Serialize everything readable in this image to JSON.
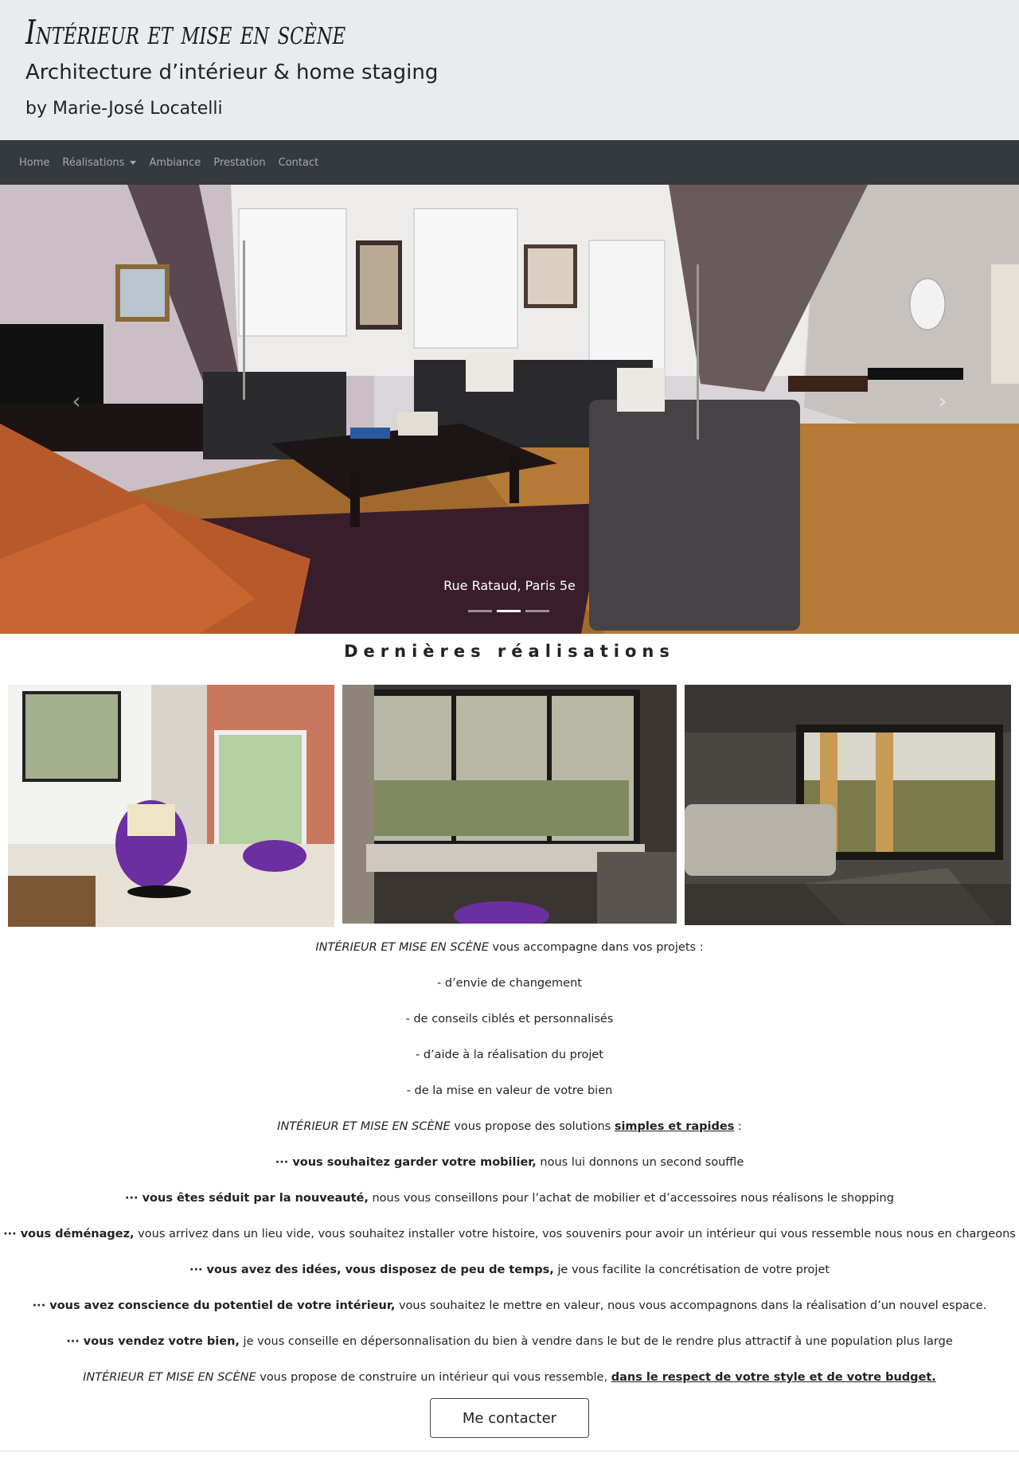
{
  "header": {
    "title": "Intérieur et mise en scène",
    "subtitle": "Architecture d’intérieur & home staging",
    "author": "by Marie-José Locatelli"
  },
  "nav": {
    "home": "Home",
    "realisations": "Réalisations",
    "ambiance": "Ambiance",
    "prestation": "Prestation",
    "contact": "Contact"
  },
  "carousel": {
    "caption": "Rue Rataud, Paris 5e",
    "prev_glyph": "‹",
    "next_glyph": "›",
    "active_index": 1,
    "slide_count": 3
  },
  "section": {
    "title": "Dernières réalisations"
  },
  "intro": {
    "brand": "INTÉRIEUR ET MISE EN SCÈNE",
    "accompagne": " vous accompagne dans vos projets :",
    "item1": "- d’envie de changement",
    "item2": "- de conseils ciblés et personnalisés",
    "item3": "- d’aide à la réalisation du projet",
    "item4": "- de la mise en valeur de votre bien",
    "propose": " vous propose des solutions ",
    "simples": "simples et rapides",
    "colon": " :"
  },
  "cases": [
    {
      "bold": "··· vous souhaitez garder votre mobilier,",
      "rest": " nous lui donnons un second souffle"
    },
    {
      "bold": "··· vous êtes séduit par la nouveauté,",
      "rest": " nous vous conseillons pour l’achat de mobilier et d’accessoires nous réalisons le shopping"
    },
    {
      "bold": "··· vous déménagez,",
      "rest": " vous arrivez dans un lieu vide, vous souhaitez installer votre histoire, vos souvenirs pour avoir un intérieur qui vous ressemble nous nous en chargeons"
    },
    {
      "bold": "··· vous avez des idées, vous disposez de peu de temps,",
      "rest": " je vous facilite la concrétisation de votre projet"
    },
    {
      "bold": "··· vous avez conscience du potentiel de votre intérieur,",
      "rest": " vous souhaitez le mettre en valeur, nous vous accompagnons dans la réalisation d’un nouvel espace."
    },
    {
      "bold": "··· vous vendez votre bien,",
      "rest": " je vous conseille en dépersonnalisation du bien à vendre dans le but de le rendre plus attractif à une population plus large"
    }
  ],
  "closing": {
    "brand": "INTÉRIEUR ET MISE EN SCÈNE",
    "text": " vous propose de construire un intérieur qui vous ressemble, ",
    "link": "dans le respect de votre style et de votre budget."
  },
  "cta": {
    "label": "Me contacter"
  },
  "colors": {
    "header_bg": "#e9ecef",
    "navbar_bg": "#343a40",
    "nav_text": "rgba(255,255,255,0.55)"
  }
}
